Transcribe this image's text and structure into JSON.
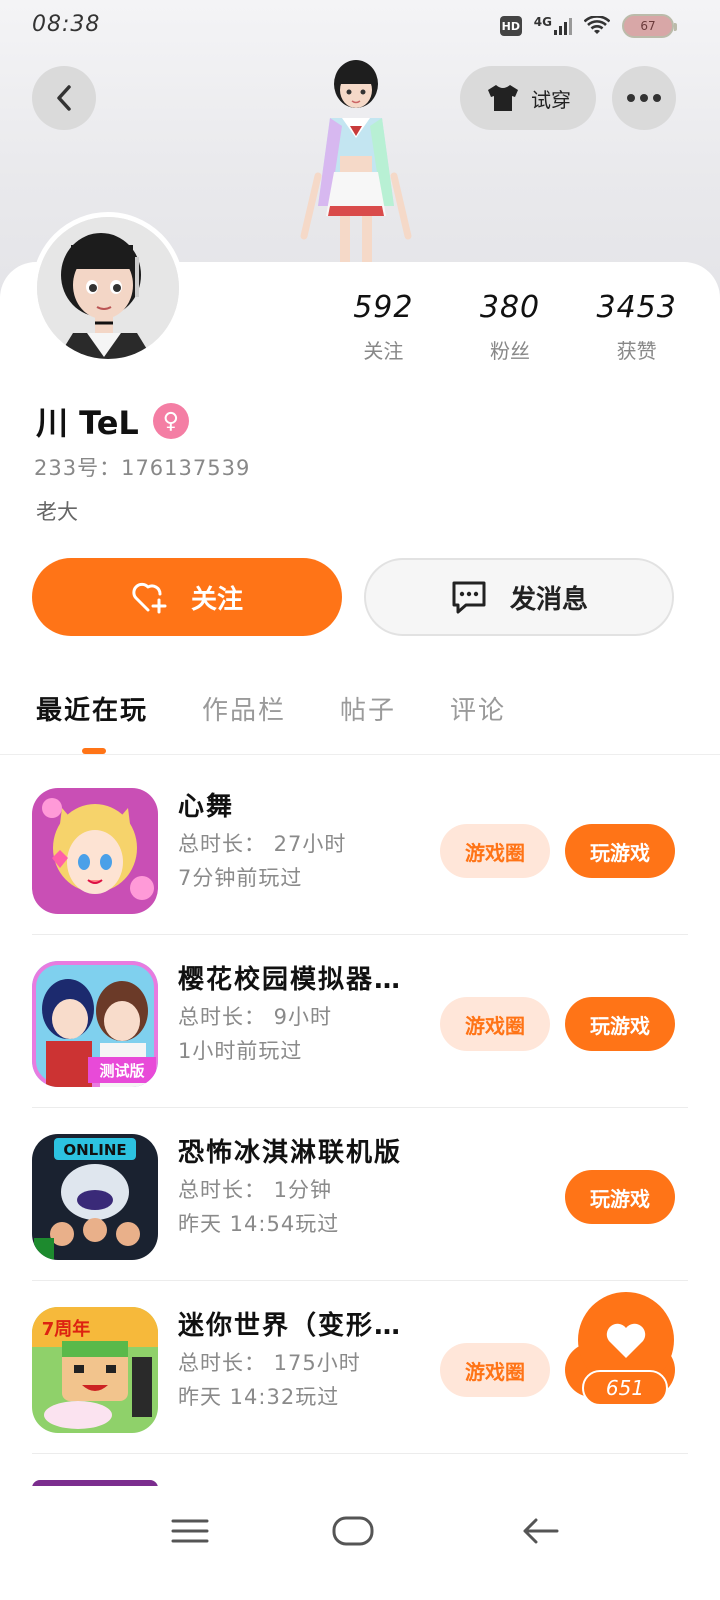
{
  "status_bar": {
    "time": "08:38",
    "hd": "HD",
    "network": "4G",
    "battery": "67"
  },
  "header": {
    "try_on_label": "试穿"
  },
  "stats": [
    {
      "value": "592",
      "label": "关注"
    },
    {
      "value": "380",
      "label": "粉丝"
    },
    {
      "value": "3453",
      "label": "获赞"
    }
  ],
  "profile": {
    "name": "川 TeL",
    "gender_icon": "female-icon",
    "uid": "233号：176137539",
    "bio": "老大"
  },
  "actions": {
    "follow_label": "关注",
    "message_label": "发消息"
  },
  "tabs": [
    {
      "label": "最近在玩",
      "active": true
    },
    {
      "label": "作品栏",
      "active": false
    },
    {
      "label": "帖子",
      "active": false
    },
    {
      "label": "评论",
      "active": false
    }
  ],
  "games": [
    {
      "title": "心舞",
      "duration": "总时长： 27小时",
      "last_played": "7分钟前玩过",
      "circle_label": "游戏圈",
      "play_label": "玩游戏"
    },
    {
      "title": "樱花校园模拟器…",
      "duration": "总时长： 9小时",
      "last_played": "1小时前玩过",
      "circle_label": "游戏圈",
      "play_label": "玩游戏",
      "icon_badge": "测试版"
    },
    {
      "title": "恐怖冰淇淋联机版",
      "duration": "总时长： 1分钟",
      "last_played": "昨天 14:54玩过",
      "play_label": "玩游戏",
      "icon_badge": "ONLINE"
    },
    {
      "title": "迷你世界（变形…",
      "duration": "总时长： 175小时",
      "last_played": "昨天 14:32玩过",
      "circle_label": "游戏圈",
      "icon_badge": "7周年"
    }
  ],
  "like_fab": {
    "count": "651"
  },
  "colors": {
    "accent": "#ff7417",
    "accent_light": "#ffe6d9",
    "female": "#f47ea4"
  }
}
